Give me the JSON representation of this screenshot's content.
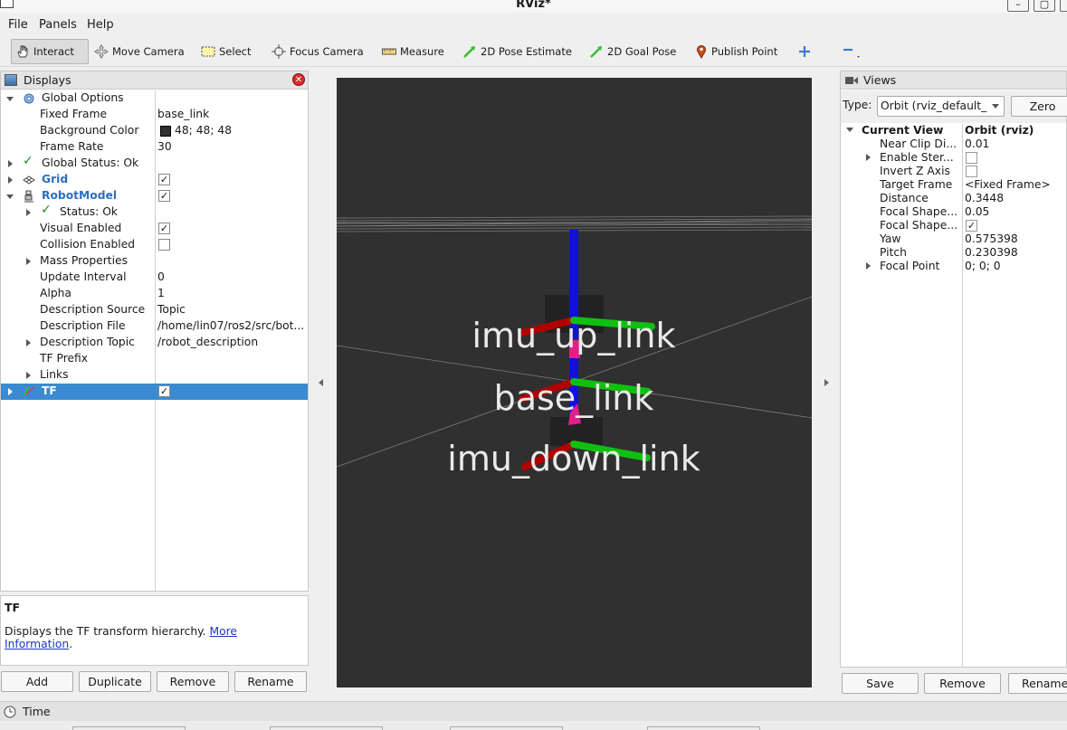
{
  "window": {
    "title": "RViz*",
    "minimize": "—",
    "maximize": "▢"
  },
  "menu": {
    "file": "File",
    "panels": "Panels",
    "help": "Help"
  },
  "toolbar": {
    "interact": "Interact",
    "move_camera": "Move Camera",
    "select": "Select",
    "focus_camera": "Focus Camera",
    "measure": "Measure",
    "pose_estimate": "2D Pose Estimate",
    "goal_pose": "2D Goal Pose",
    "publish_point": "Publish Point"
  },
  "displays": {
    "title": "Displays",
    "rows": [
      {
        "name": "Global Options",
        "value": ""
      },
      {
        "name": "Fixed Frame",
        "value": "base_link"
      },
      {
        "name": "Background Color",
        "value": "48; 48; 48"
      },
      {
        "name": "Frame Rate",
        "value": "30"
      },
      {
        "name": "Global Status: Ok",
        "value": ""
      },
      {
        "name": "Grid",
        "value": ""
      },
      {
        "name": "RobotModel",
        "value": ""
      },
      {
        "name": "Status: Ok",
        "value": ""
      },
      {
        "name": "Visual Enabled",
        "value": ""
      },
      {
        "name": "Collision Enabled",
        "value": ""
      },
      {
        "name": "Mass Properties",
        "value": ""
      },
      {
        "name": "Update Interval",
        "value": "0"
      },
      {
        "name": "Alpha",
        "value": "1"
      },
      {
        "name": "Description Source",
        "value": "Topic"
      },
      {
        "name": "Description File",
        "value": "/home/lin07/ros2/src/bot..."
      },
      {
        "name": "Description Topic",
        "value": "/robot_description"
      },
      {
        "name": "TF Prefix",
        "value": ""
      },
      {
        "name": "Links",
        "value": ""
      },
      {
        "name": "TF",
        "value": ""
      }
    ],
    "colors": {
      "background_swatch": "#303030",
      "selection": "#3a8bd1"
    }
  },
  "description": {
    "title": "TF",
    "text": "Displays the TF transform hierarchy.",
    "link": "More Information",
    "suffix": "."
  },
  "display_buttons": {
    "add": "Add",
    "duplicate": "Duplicate",
    "remove": "Remove",
    "rename": "Rename"
  },
  "scene": {
    "labels": [
      "imu_up_link",
      "base_link",
      "imu_down_link"
    ]
  },
  "views": {
    "title": "Views",
    "type_label": "Type:",
    "type_value": "Orbit (rviz_default_p",
    "zero": "Zero",
    "current_view": "Current View",
    "current_view_type": "Orbit (rviz)",
    "rows": [
      {
        "name": "Near Clip Di...",
        "value": "0.01"
      },
      {
        "name": "Enable Ster...",
        "value": ""
      },
      {
        "name": "Invert Z Axis",
        "value": ""
      },
      {
        "name": "Target Frame",
        "value": "<Fixed Frame>"
      },
      {
        "name": "Distance",
        "value": "0.3448"
      },
      {
        "name": "Focal Shape...",
        "value": "0.05"
      },
      {
        "name": "Focal Shape...",
        "value": ""
      },
      {
        "name": "Yaw",
        "value": "0.575398"
      },
      {
        "name": "Pitch",
        "value": "0.230398"
      },
      {
        "name": "Focal Point",
        "value": "0; 0; 0"
      }
    ],
    "buttons": {
      "save": "Save",
      "remove": "Remove",
      "rename": "Rename"
    }
  },
  "time": {
    "title": "Time"
  }
}
